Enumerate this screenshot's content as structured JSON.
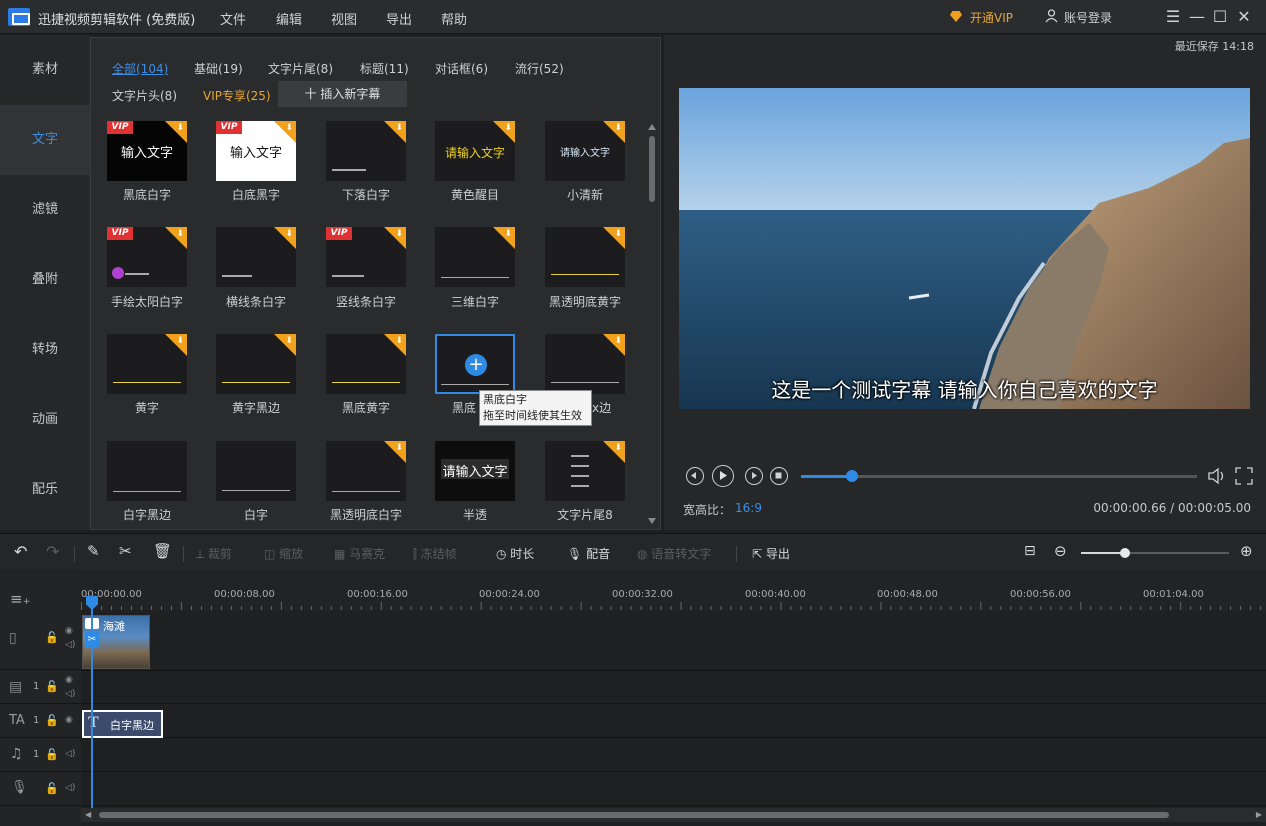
{
  "titlebar": {
    "app_title": "迅捷视频剪辑软件 (免费版)",
    "menu": [
      "文件",
      "编辑",
      "视图",
      "导出",
      "帮助"
    ],
    "vip": "开通VIP",
    "account": "账号登录"
  },
  "sidebar": {
    "items": [
      "素材",
      "文字",
      "滤镜",
      "叠附",
      "转场",
      "动画",
      "配乐"
    ],
    "active": "文字"
  },
  "library": {
    "categories": [
      "全部(104)",
      "基础(19)",
      "文字片尾(8)",
      "标题(11)",
      "对话框(6)",
      "流行(52)",
      "文字片头(8)",
      "VIP专享(25)"
    ],
    "insert_button": "十 插入新字幕",
    "thumb_texts": {
      "input_text": "输入文字",
      "please_input": "请输入文字",
      "vip": "VIP"
    },
    "items": [
      "黑底白字",
      "白底黑字",
      "下落白字",
      "黄色醒目",
      "小清新",
      "手绘太阳白字",
      "横线条白字",
      "竖线条白字",
      "三维白字",
      "黑透明底黄字",
      "黄字",
      "黄字黑边",
      "黑底黄字",
      "黑底",
      "x边",
      "白字黑边",
      "白字",
      "黑透明底白字",
      "半透",
      "文字片尾8"
    ],
    "tooltip": [
      "黑底白字",
      "拖至时间线使其生效"
    ]
  },
  "preview": {
    "last_saved": "最近保存 14:18",
    "subtitle": "这是一个测试字幕 请输入你自己喜欢的文字",
    "aspect_label": "宽高比：",
    "aspect_value": "16:9",
    "timecode": "00:00:00.66 / 00:00:05.00",
    "progress": 0.13
  },
  "toolbar": {
    "crop": "裁剪",
    "zoom": "缩放",
    "mosaic": "马赛克",
    "freeze": "冻结帧",
    "duration": "时长",
    "dub": "配音",
    "speech_to_text": "语音转文字",
    "export": "导出"
  },
  "timeline": {
    "ticks": [
      "00:00:00.00",
      "00:00:08.00",
      "00:00:16.00",
      "00:00:24.00",
      "00:00:32.00",
      "00:00:40.00",
      "00:00:48.00",
      "00:00:56.00",
      "00:01:04.00"
    ],
    "video_clip_name": "海滩",
    "text_clip_name": "白字黑边",
    "track_index": "1"
  },
  "colors": {
    "accent": "#2f8ae5",
    "vip": "#e6a63c"
  }
}
